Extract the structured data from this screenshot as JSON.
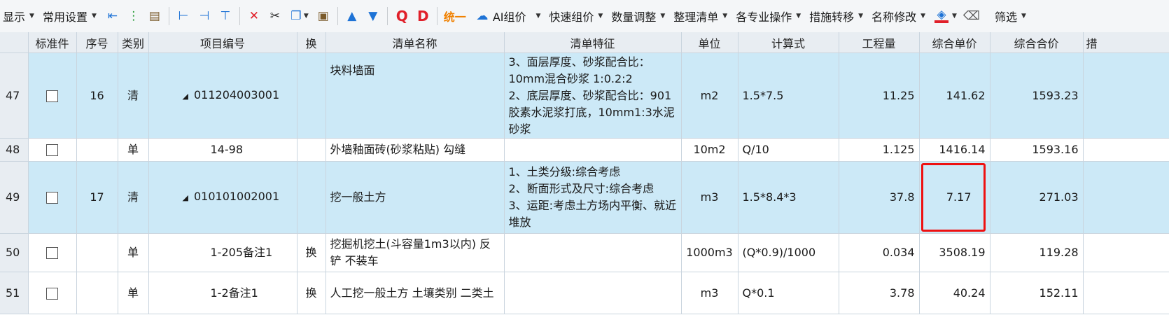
{
  "toolbar": {
    "display": "显示",
    "common_settings": "常用设置",
    "tongyi": "统一",
    "ai_price": "AI组价",
    "quick_price": "快速组价",
    "quantity_adjust": "数量调整",
    "organize_list": "整理清单",
    "specialty_ops": "各专业操作",
    "measure_transfer": "措施转移",
    "rename": "名称修改",
    "filter": "筛选",
    "glyph_q": "Q",
    "glyph_d": "D",
    "colors": {
      "fill_underline": "#e0202a",
      "accent_blue": "#1e73d6"
    }
  },
  "columns": {
    "standard": "标准件",
    "seq": "序号",
    "category": "类别",
    "code": "项目编号",
    "swap": "换",
    "name": "清单名称",
    "feature": "清单特征",
    "unit": "单位",
    "formula": "计算式",
    "quantity": "工程量",
    "unit_price": "综合单价",
    "total": "综合合价",
    "extra": "措"
  },
  "rows": [
    {
      "rownum": "47",
      "seq": "16",
      "category": "清",
      "code": "011204003001",
      "swap": "",
      "name": "块料墙面",
      "feature": "3、面层厚度、砂浆配合比：10mm混合砂浆 1:0.2:2\n2、底层厚度、砂浆配合比：901胶素水泥浆打底，10mm1:3水泥砂浆",
      "unit": "m2",
      "formula": "1.5*7.5",
      "quantity": "11.25",
      "unit_price": "141.62",
      "total": "1593.23"
    },
    {
      "rownum": "48",
      "seq": "",
      "category": "单",
      "code": "14-98",
      "swap": "",
      "name": "外墙釉面砖(砂浆粘贴) 勾缝",
      "feature": "",
      "unit": "10m2",
      "formula": "Q/10",
      "quantity": "1.125",
      "unit_price": "1416.14",
      "total": "1593.16"
    },
    {
      "rownum": "49",
      "seq": "17",
      "category": "清",
      "code": "010101002001",
      "swap": "",
      "name": "挖一般土方",
      "feature": "1、土类分级:综合考虑\n2、断面形式及尺寸:综合考虑\n3、运距:考虑土方场内平衡、就近堆放",
      "unit": "m3",
      "formula": "1.5*8.4*3",
      "quantity": "37.8",
      "unit_price": "7.17",
      "total": "271.03"
    },
    {
      "rownum": "50",
      "seq": "",
      "category": "单",
      "code": "1-205备注1",
      "swap": "换",
      "name": "挖掘机挖土(斗容量1m3以内) 反铲 不装车",
      "feature": "",
      "unit": "1000m3",
      "formula": "(Q*0.9)/1000",
      "quantity": "0.034",
      "unit_price": "3508.19",
      "total": "119.28"
    },
    {
      "rownum": "51",
      "seq": "",
      "category": "单",
      "code": "1-2备注1",
      "swap": "换",
      "name": "人工挖一般土方 土壤类别 二类土",
      "feature": "",
      "unit": "m3",
      "formula": "Q*0.1",
      "quantity": "3.78",
      "unit_price": "40.24",
      "total": "152.11"
    }
  ]
}
